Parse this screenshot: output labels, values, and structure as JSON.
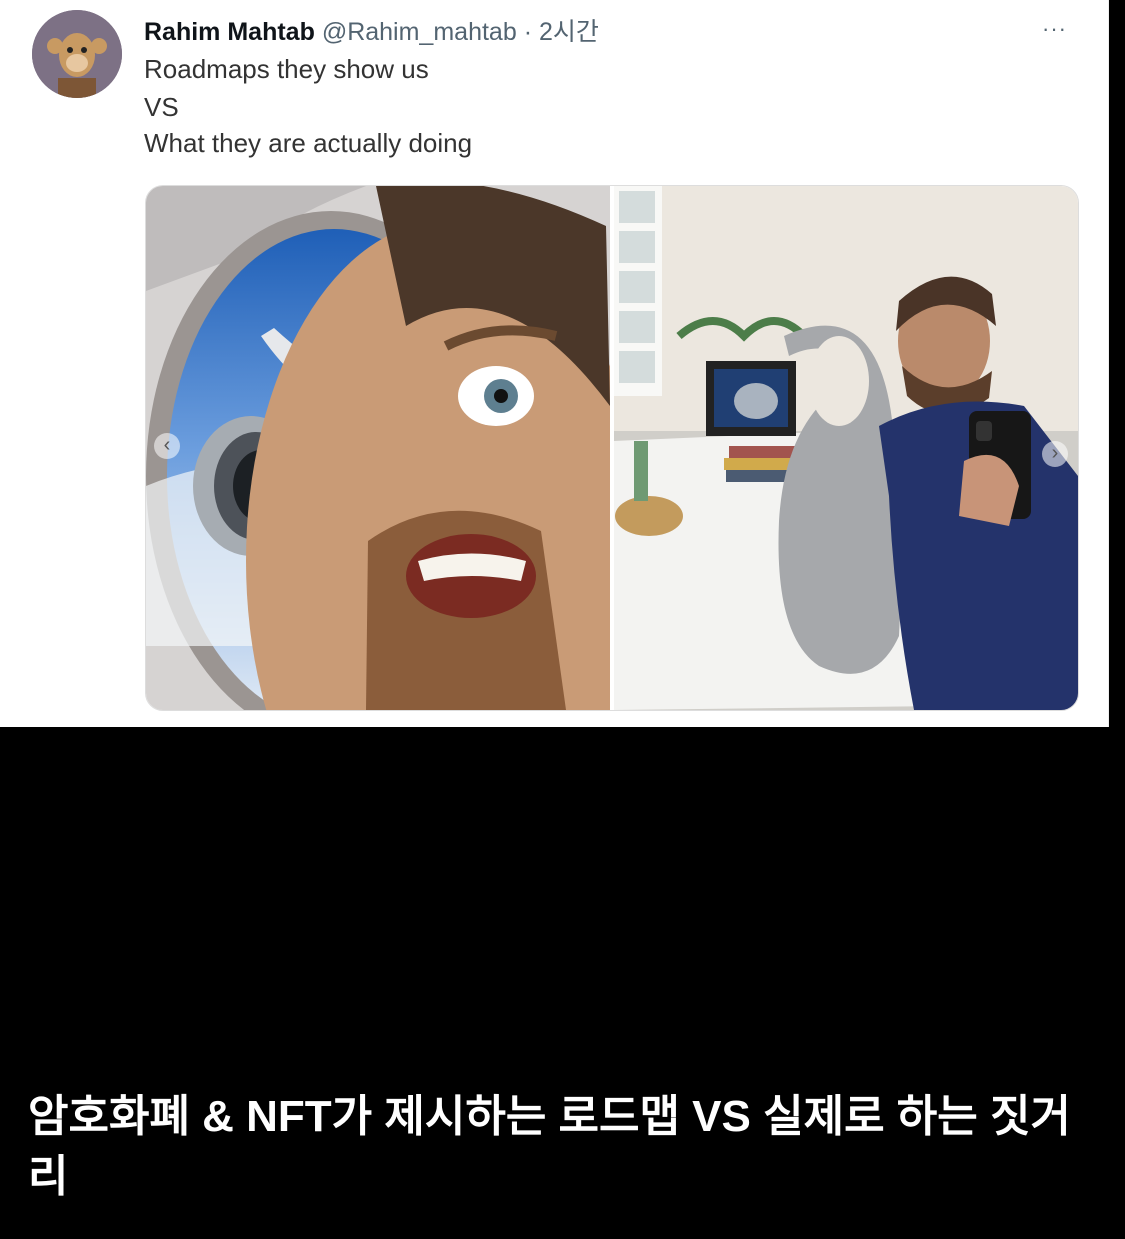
{
  "tweet": {
    "author_name": "Rahim Mahtab",
    "handle": "@Rahim_mahtab",
    "separator": "·",
    "time": "2시간",
    "more": "···",
    "lines": [
      "Roadmaps they show us",
      "VS",
      "What they are actually doing"
    ]
  },
  "media": {
    "left_image": "selfie-airplane-window-icon",
    "right_image": "toilet-seat-window-icon",
    "prev_icon": "‹",
    "next_icon": "›"
  },
  "caption": "암호화폐 & NFT가 제시하는 로드맵 VS 실제로 하는 짓거리"
}
